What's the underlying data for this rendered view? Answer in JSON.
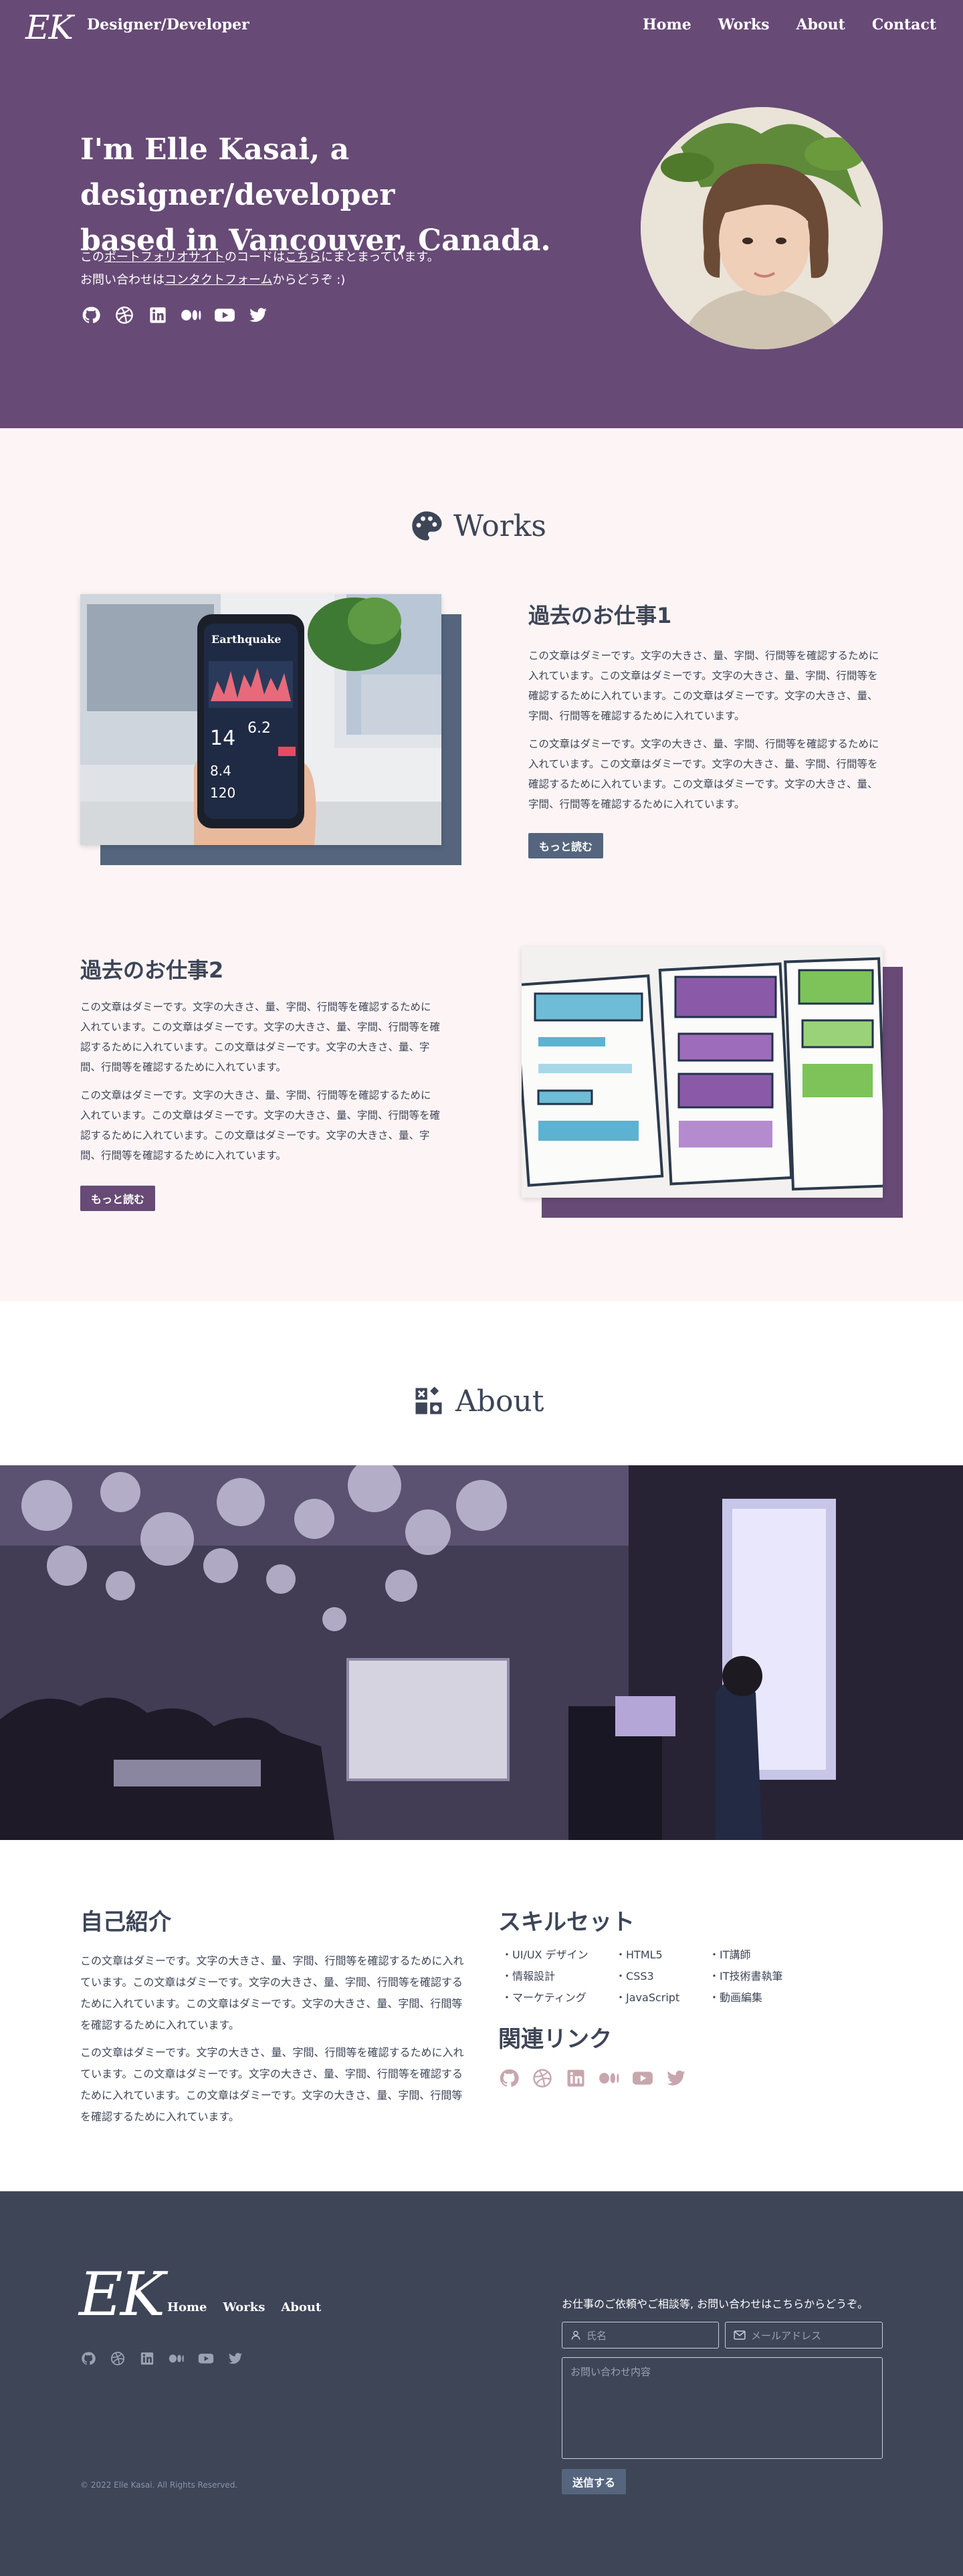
{
  "header": {
    "logo": "EK",
    "brand": "Designer/Developer",
    "nav": [
      "Home",
      "Works",
      "About",
      "Contact"
    ]
  },
  "hero": {
    "title_prefix": "I'm ",
    "name": "Elle Kasai",
    "title_mid": ", a ",
    "role": "designer/developer",
    "title_line2": "based in Vancouver, Canada.",
    "desc1_a": "この",
    "desc1_link": "ポートフォリオサイト",
    "desc1_b": "のコードは",
    "desc1_link2": "こちら",
    "desc1_c": "にまとまっています。",
    "desc2_a": "お問い合わせは",
    "desc2_link": "コンタクトフォーム",
    "desc2_b": "からどうぞ :)"
  },
  "works": {
    "title": "Works",
    "items": [
      {
        "title": "過去のお仕事1",
        "p1": "この文章はダミーです。文字の大きさ、量、字間、行間等を確認するために入れています。この文章はダミーです。文字の大きさ、量、字間、行間等を確認するために入れています。この文章はダミーです。文字の大きさ、量、字間、行間等を確認するために入れています。",
        "p2": "この文章はダミーです。文字の大きさ、量、字間、行間等を確認するために入れています。この文章はダミーです。文字の大きさ、量、字間、行間等を確認するために入れています。この文章はダミーです。文字の大きさ、量、字間、行間等を確認するために入れています。",
        "button": "もっと読む",
        "phone_app": "Earthquake",
        "phone_values": [
          "14",
          "6.2",
          "8.4",
          "120"
        ]
      },
      {
        "title": "過去のお仕事2",
        "p1": "この文章はダミーです。文字の大きさ、量、字間、行間等を確認するために入れています。この文章はダミーです。文字の大きさ、量、字間、行間等を確認するために入れています。この文章はダミーです。文字の大きさ、量、字間、行間等を確認するために入れています。",
        "p2": "この文章はダミーです。文字の大きさ、量、字間、行間等を確認するために入れています。この文章はダミーです。文字の大きさ、量、字間、行間等を確認するために入れています。この文章はダミーです。文字の大きさ、量、字間、行間等を確認するために入れています。",
        "button": "もっと読む"
      }
    ]
  },
  "about": {
    "title": "About",
    "bio_title": "自己紹介",
    "bio_p1": "この文章はダミーです。文字の大きさ、量、字間、行間等を確認するために入れています。この文章はダミーです。文字の大きさ、量、字間、行間等を確認するために入れています。この文章はダミーです。文字の大きさ、量、字間、行間等を確認するために入れています。",
    "bio_p2": "この文章はダミーです。文字の大きさ、量、字間、行間等を確認するために入れています。この文章はダミーです。文字の大きさ、量、字間、行間等を確認するために入れています。この文章はダミーです。文字の大きさ、量、字間、行間等を確認するために入れています。",
    "skills_title": "スキルセット",
    "skills": [
      "UI/UX デザイン",
      "HTML5",
      "IT講師",
      "情報設計",
      "CSS3",
      "IT技術書執筆",
      "マーケティング",
      "JavaScript",
      "動画編集"
    ],
    "links_title": "関連リンク"
  },
  "footer": {
    "logo": "EK",
    "links": [
      "Home",
      "Works",
      "About"
    ],
    "copyright": "© 2022 Elle Kasai. All Rights Reserved.",
    "intro": "お仕事のご依頼やご相談等, お問い合わせはこちらからどうぞ。",
    "name_placeholder": "氏名",
    "email_placeholder": "メールアドレス",
    "message_placeholder": "お問い合わせ内容",
    "submit": "送信する"
  },
  "social_icons": [
    "github-icon",
    "dribbble-icon",
    "linkedin-icon",
    "medium-icon",
    "youtube-icon",
    "twitter-icon"
  ],
  "colors": {
    "purple": "#674a76",
    "slate": "#3d4557",
    "blush": "#fdf5f5",
    "shadow_blue": "#55657d",
    "muted_icon": "#c7a7ad"
  }
}
